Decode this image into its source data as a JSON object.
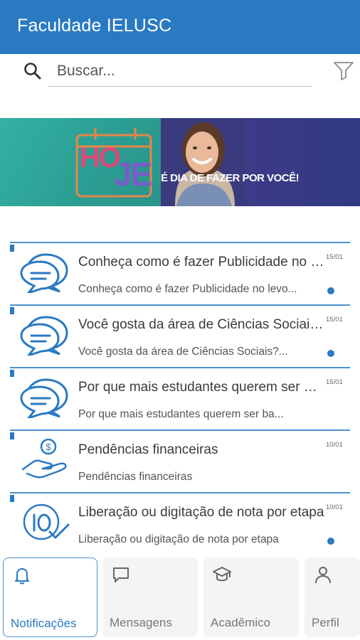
{
  "app": {
    "title": "Faculdade IELUSC"
  },
  "search": {
    "placeholder": "Buscar..."
  },
  "banner": {
    "hoje_part1": "HO",
    "hoje_part2": "JE",
    "tagline": "É DIA DE FAZER POR VOCÊ!"
  },
  "notifications": [
    {
      "title": "Conheça como é fazer Publicidade no levo...",
      "subtitle": "Conheça como é fazer Publicidade no levo...",
      "date": "15/01",
      "unread": true,
      "icon": "chat-bubbles-icon"
    },
    {
      "title": "Você gosta da área de Ciências Sociais?...",
      "subtitle": "Você gosta da área de Ciências Sociais?...",
      "date": "15/01",
      "unread": true,
      "icon": "chat-bubbles-icon"
    },
    {
      "title": "Por que mais estudantes querem ser ba...",
      "subtitle": "Por que mais estudantes querem ser ba...",
      "date": "15/01",
      "unread": false,
      "icon": "chat-bubbles-icon"
    },
    {
      "title": "Pendências financeiras",
      "subtitle": "Pendências financeiras",
      "date": "10/01",
      "unread": false,
      "icon": "hand-coin-icon"
    },
    {
      "title": "Liberação ou digitação de nota por etapa",
      "subtitle": "Liberação ou digitação de nota por etapa",
      "date": "10/01",
      "unread": true,
      "icon": "grade-ten-icon"
    }
  ],
  "tabs": [
    {
      "label": "Notificações",
      "icon": "bell-icon",
      "active": true
    },
    {
      "label": "Mensagens",
      "icon": "message-icon",
      "active": false
    },
    {
      "label": "Acadêmico",
      "icon": "graduation-cap-icon",
      "active": false
    },
    {
      "label": "Perfil",
      "icon": "person-icon",
      "active": false
    }
  ],
  "colors": {
    "primary": "#2a7ac2",
    "accent_line": "#4e92cf"
  }
}
